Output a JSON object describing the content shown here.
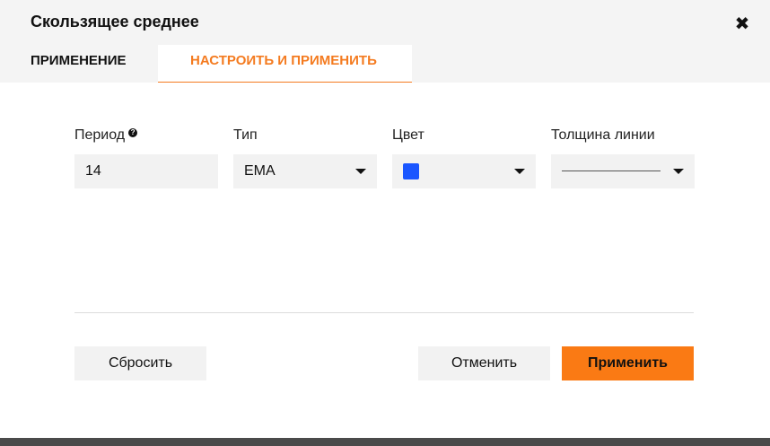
{
  "dialog": {
    "title": "Скользящее среднее",
    "close_icon": "close-icon"
  },
  "tabs": [
    {
      "label": "ПРИМЕНЕНИЕ",
      "active": false
    },
    {
      "label": "НАСТРОИТЬ И ПРИМЕНИТЬ",
      "active": true
    }
  ],
  "accent_color": "#f47b20",
  "fields": {
    "period": {
      "label": "Период",
      "value": "14",
      "help_icon": "help-icon"
    },
    "type": {
      "label": "Тип",
      "value": "EMA"
    },
    "color": {
      "label": "Цвет",
      "value": "#1a56ff"
    },
    "line_width": {
      "label": "Толщина линии",
      "value_sample": "thin-line"
    }
  },
  "buttons": {
    "reset": "Сбросить",
    "cancel": "Отменить",
    "apply": "Применить"
  }
}
